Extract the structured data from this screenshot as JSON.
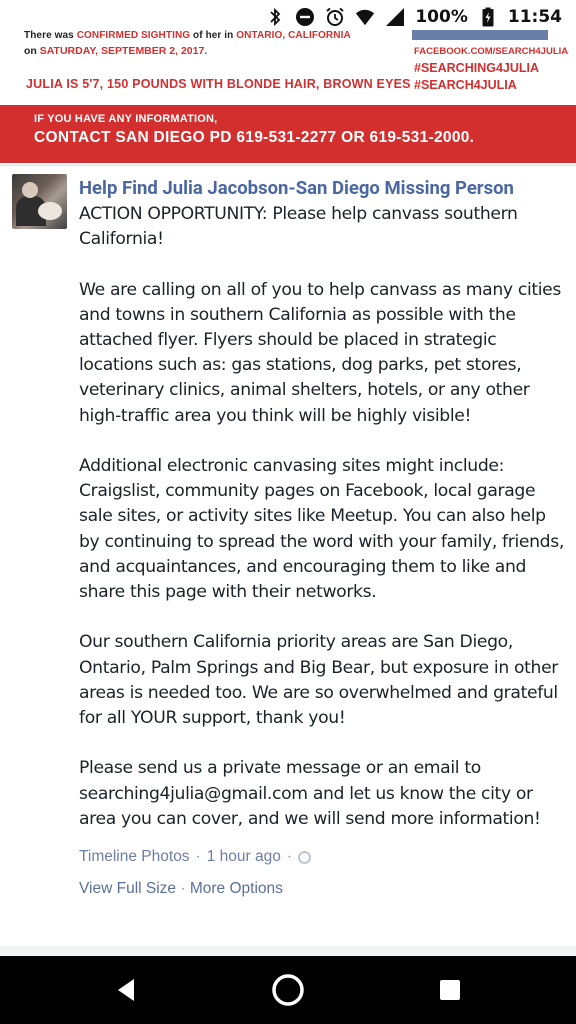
{
  "status_bar": {
    "battery": "100%",
    "time": "11:54",
    "icons": [
      "bluetooth-icon",
      "dnd-icon",
      "alarm-icon",
      "wifi-icon",
      "signal-icon",
      "battery-charging-icon"
    ]
  },
  "flyer": {
    "top_line_start": "There was ",
    "top_line_red1": "CONFIRMED SIGHTING",
    "top_line_mid": " of her in ",
    "top_line_red2": "ONTARIO, CALIFORNIA",
    "date_prefix": "on ",
    "date_red": "SATURDAY, SEPTEMBER 2, 2017.",
    "description": "JULIA IS 5'7, 150 POUNDS WITH BLONDE HAIR, BROWN EYES",
    "facebook": "FACEBOOK.COM/SEARCH4JULIA",
    "hashtag1": "#SEARCHING4JULIA",
    "hashtag2": "#SEARCH4JULIA",
    "banner_line1": "IF YOU HAVE ANY INFORMATION,",
    "banner_line2": "CONTACT SAN DIEGO PD 619-531-2277 OR 619-531-2000."
  },
  "post": {
    "page_name": "Help Find Julia Jacobson-San Diego Missing Person",
    "body": "ACTION OPPORTUNITY: Please help canvass southern California!\n\nWe are calling on all of you to help canvass as many cities and towns in southern California as possible with the attached flyer. Flyers should be placed in strategic locations such as: gas stations, dog parks, pet stores, veterinary clinics, animal shelters, hotels, or any other high-traffic area you think will be highly visible!\n\nAdditional electronic canvasing sites might include: Craigslist, community pages on Facebook, local garage sale sites, or activity sites like Meetup. You can also help by continuing to spread the word with your family, friends, and acquaintances, and encouraging them to like and share this page with their networks.\n\nOur southern California priority areas are San Diego, Ontario, Palm Springs and Big Bear, but exposure in other areas is needed too. We are so overwhelmed and grateful for all YOUR support, thank you!\n\nPlease send us a private message or an email to searching4julia@gmail.com and let us know the city or area you can cover, and we will send more information!",
    "album": "Timeline Photos",
    "separator": "·",
    "time_ago": "1 hour ago",
    "privacy_icon": "globe-icon",
    "view_full_size": "View Full Size",
    "more_options": "More Options"
  },
  "nav": {
    "back_icon": "back-triangle-icon",
    "home_icon": "home-circle-icon",
    "recent_icon": "recent-square-icon"
  },
  "colors": {
    "link_blue": "#4b67a1",
    "flyer_red": "#d32f2f",
    "text_dark": "#1d2129",
    "meta_gray": "#7f8fa9"
  }
}
